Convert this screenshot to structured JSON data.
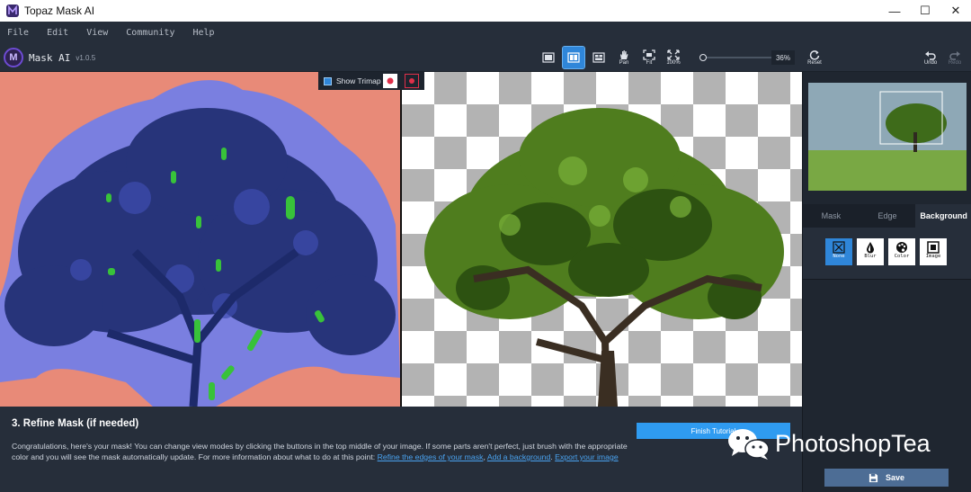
{
  "window": {
    "title": "Topaz Mask AI",
    "minimize": "—",
    "maximize": "☐",
    "close": "✕"
  },
  "menu": [
    "File",
    "Edit",
    "View",
    "Community",
    "Help"
  ],
  "brand": {
    "logo_letter": "M",
    "name": "Mask AI",
    "version": "v1.0.5"
  },
  "toolbar": {
    "pan_label": "Pan",
    "fit_label": "Fit",
    "zoom100_label": "100%",
    "zoom_value": "36%",
    "zoom_fraction": 0.0,
    "reset_label": "Reset",
    "undo_label": "Undo",
    "redo_label": "Redo",
    "active_view": "split"
  },
  "trimap": {
    "label": "Show Trimap"
  },
  "panel": {
    "tabs": [
      {
        "label": "Mask"
      },
      {
        "label": "Edge"
      },
      {
        "label": "Background",
        "active": true
      }
    ],
    "background_options": [
      {
        "label": "None",
        "icon": "none-icon",
        "active": true
      },
      {
        "label": "Blur",
        "icon": "blur-icon"
      },
      {
        "label": "Color",
        "icon": "color-icon"
      },
      {
        "label": "Image",
        "icon": "image-icon"
      }
    ],
    "save_label": "Save"
  },
  "tutorial": {
    "heading": "3. Refine Mask (if needed)",
    "body": "Congratulations, here's your mask! You can change view modes by clicking the buttons in the top middle of your image. If some parts aren't perfect, just brush with the appropriate color and you will see the mask automatically update. For more information about what to do at this point: ",
    "link1": "Refine the edges of your mask",
    "sep": ", ",
    "link2": "Add a background",
    "sep2": ". ",
    "link3": "Export your image",
    "finish_label": "Finish Tutorial"
  },
  "watermark": {
    "text": "PhotoshopTea"
  },
  "colors": {
    "accent": "#2f86d9",
    "keep": "#5a72d8",
    "drop": "#e88a78",
    "edge": "#2ecc40",
    "panel": "#262e3a"
  }
}
